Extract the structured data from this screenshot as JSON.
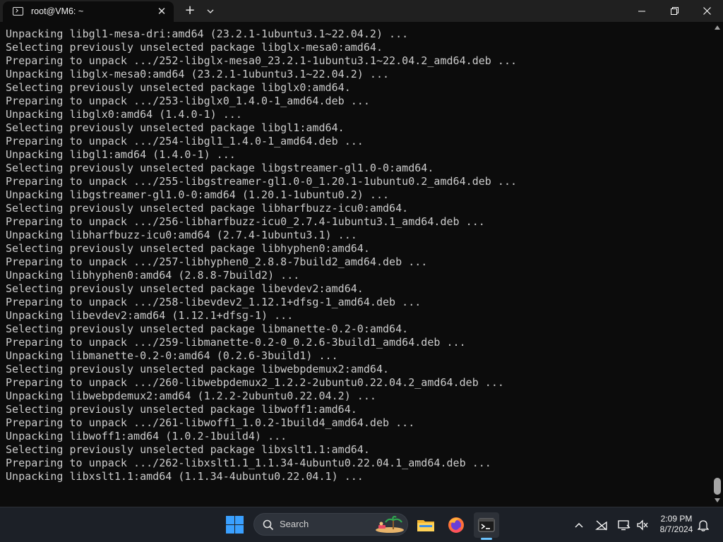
{
  "window": {
    "tab_title": "root@VM6: ~",
    "tab_close_glyph": "✕",
    "new_tab_glyph": "+"
  },
  "terminal": {
    "lines": [
      "Unpacking libgl1-mesa-dri:amd64 (23.2.1-1ubuntu3.1~22.04.2) ...",
      "Selecting previously unselected package libglx-mesa0:amd64.",
      "Preparing to unpack .../252-libglx-mesa0_23.2.1-1ubuntu3.1~22.04.2_amd64.deb ...",
      "Unpacking libglx-mesa0:amd64 (23.2.1-1ubuntu3.1~22.04.2) ...",
      "Selecting previously unselected package libglx0:amd64.",
      "Preparing to unpack .../253-libglx0_1.4.0-1_amd64.deb ...",
      "Unpacking libglx0:amd64 (1.4.0-1) ...",
      "Selecting previously unselected package libgl1:amd64.",
      "Preparing to unpack .../254-libgl1_1.4.0-1_amd64.deb ...",
      "Unpacking libgl1:amd64 (1.4.0-1) ...",
      "Selecting previously unselected package libgstreamer-gl1.0-0:amd64.",
      "Preparing to unpack .../255-libgstreamer-gl1.0-0_1.20.1-1ubuntu0.2_amd64.deb ...",
      "Unpacking libgstreamer-gl1.0-0:amd64 (1.20.1-1ubuntu0.2) ...",
      "Selecting previously unselected package libharfbuzz-icu0:amd64.",
      "Preparing to unpack .../256-libharfbuzz-icu0_2.7.4-1ubuntu3.1_amd64.deb ...",
      "Unpacking libharfbuzz-icu0:amd64 (2.7.4-1ubuntu3.1) ...",
      "Selecting previously unselected package libhyphen0:amd64.",
      "Preparing to unpack .../257-libhyphen0_2.8.8-7build2_amd64.deb ...",
      "Unpacking libhyphen0:amd64 (2.8.8-7build2) ...",
      "Selecting previously unselected package libevdev2:amd64.",
      "Preparing to unpack .../258-libevdev2_1.12.1+dfsg-1_amd64.deb ...",
      "Unpacking libevdev2:amd64 (1.12.1+dfsg-1) ...",
      "Selecting previously unselected package libmanette-0.2-0:amd64.",
      "Preparing to unpack .../259-libmanette-0.2-0_0.2.6-3build1_amd64.deb ...",
      "Unpacking libmanette-0.2-0:amd64 (0.2.6-3build1) ...",
      "Selecting previously unselected package libwebpdemux2:amd64.",
      "Preparing to unpack .../260-libwebpdemux2_1.2.2-2ubuntu0.22.04.2_amd64.deb ...",
      "Unpacking libwebpdemux2:amd64 (1.2.2-2ubuntu0.22.04.2) ...",
      "Selecting previously unselected package libwoff1:amd64.",
      "Preparing to unpack .../261-libwoff1_1.0.2-1build4_amd64.deb ...",
      "Unpacking libwoff1:amd64 (1.0.2-1build4) ...",
      "Selecting previously unselected package libxslt1.1:amd64.",
      "Preparing to unpack .../262-libxslt1.1_1.1.34-4ubuntu0.22.04.1_amd64.deb ...",
      "Unpacking libxslt1.1:amd64 (1.1.34-4ubuntu0.22.04.1) ..."
    ],
    "text_color": "#cccccc",
    "background": "#0c0c0c"
  },
  "taskbar": {
    "search_label": "Search",
    "apps": [
      "file-explorer-icon",
      "firefox-icon",
      "terminal-icon"
    ],
    "clock": {
      "time": "2:09 PM",
      "date": "8/7/2024"
    },
    "accent": "#3aa0ff"
  }
}
